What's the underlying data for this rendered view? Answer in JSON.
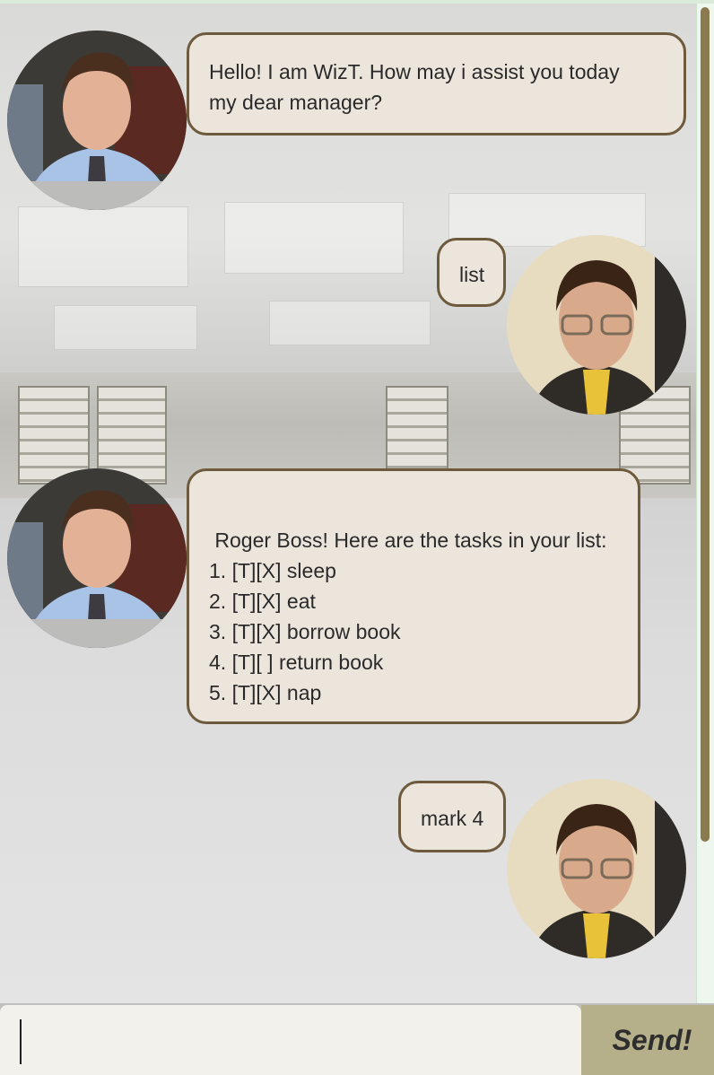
{
  "messages": [
    {
      "sender": "bot",
      "lines": [
        "Hello! I am WizT. How may i assist you today",
        "my dear manager?"
      ]
    },
    {
      "sender": "user",
      "lines": [
        "list"
      ]
    },
    {
      "sender": "bot",
      "lines": [
        " Roger Boss! Here are the tasks in your list:",
        "1. [T][X] sleep",
        "2. [T][X] eat",
        "3. [T][X] borrow book",
        "4. [T][ ] return book",
        "5. [T][X] nap"
      ]
    },
    {
      "sender": "user",
      "lines": [
        "mark 4"
      ]
    }
  ],
  "input": {
    "value": ""
  },
  "send_button": {
    "label": "Send!"
  },
  "colors": {
    "bubble_bg": "#ece5dc",
    "bubble_border": "#6e5b3e",
    "send_bg": "#b6b08a",
    "scroll_thumb": "#8b7a50"
  },
  "icons": {
    "bot_avatar": "bot-avatar-photo",
    "user_avatar": "user-avatar-photo"
  }
}
